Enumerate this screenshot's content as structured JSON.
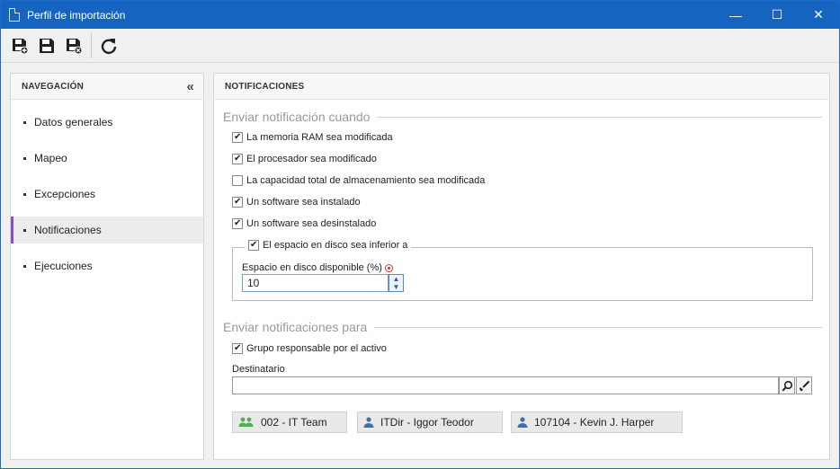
{
  "window": {
    "title": "Perfil de importación",
    "minimize": "—",
    "maximize": "☐",
    "close": "✕"
  },
  "toolbar": {
    "buttons": [
      {
        "name": "save-new-button",
        "icon": "save-plus-icon"
      },
      {
        "name": "save-button",
        "icon": "save-icon"
      },
      {
        "name": "save-close-button",
        "icon": "save-close-icon"
      },
      {
        "name": "refresh-button",
        "icon": "refresh-icon"
      }
    ]
  },
  "nav": {
    "header": "NAVEGACIÓN",
    "collapse": "«",
    "items": [
      {
        "label": "Datos generales",
        "active": false
      },
      {
        "label": "Mapeo",
        "active": false
      },
      {
        "label": "Excepciones",
        "active": false
      },
      {
        "label": "Notificaciones",
        "active": true
      },
      {
        "label": "Ejecuciones",
        "active": false
      }
    ]
  },
  "main": {
    "header": "NOTIFICACIONES",
    "section1": {
      "title": "Enviar notificación cuando",
      "options": [
        {
          "label": "La memoria RAM sea modificada",
          "checked": true
        },
        {
          "label": "El procesador sea modificado",
          "checked": true
        },
        {
          "label": "La capacidad total de almacenamiento sea modificada",
          "checked": false
        },
        {
          "label": "Un software sea instalado",
          "checked": true
        },
        {
          "label": "Un software sea desinstalado",
          "checked": true
        }
      ],
      "disk": {
        "label": "El espacio en disco sea inferior a",
        "checked": true,
        "field_label": "Espacio en disco disponible (%)",
        "value": "10"
      }
    },
    "section2": {
      "title": "Enviar notificaciones para",
      "group_option": {
        "label": "Grupo responsable por el activo",
        "checked": true
      },
      "recipient_label": "Destinatario",
      "recipient_value": "",
      "recipients": [
        {
          "label": "002 - IT Team",
          "type": "group",
          "color": "#4caf50"
        },
        {
          "label": "ITDir - Iggor Teodor",
          "type": "user",
          "color": "#3b6fb6"
        },
        {
          "label": "107104 - Kevin J. Harper",
          "type": "user",
          "color": "#3b6fb6"
        }
      ]
    }
  }
}
